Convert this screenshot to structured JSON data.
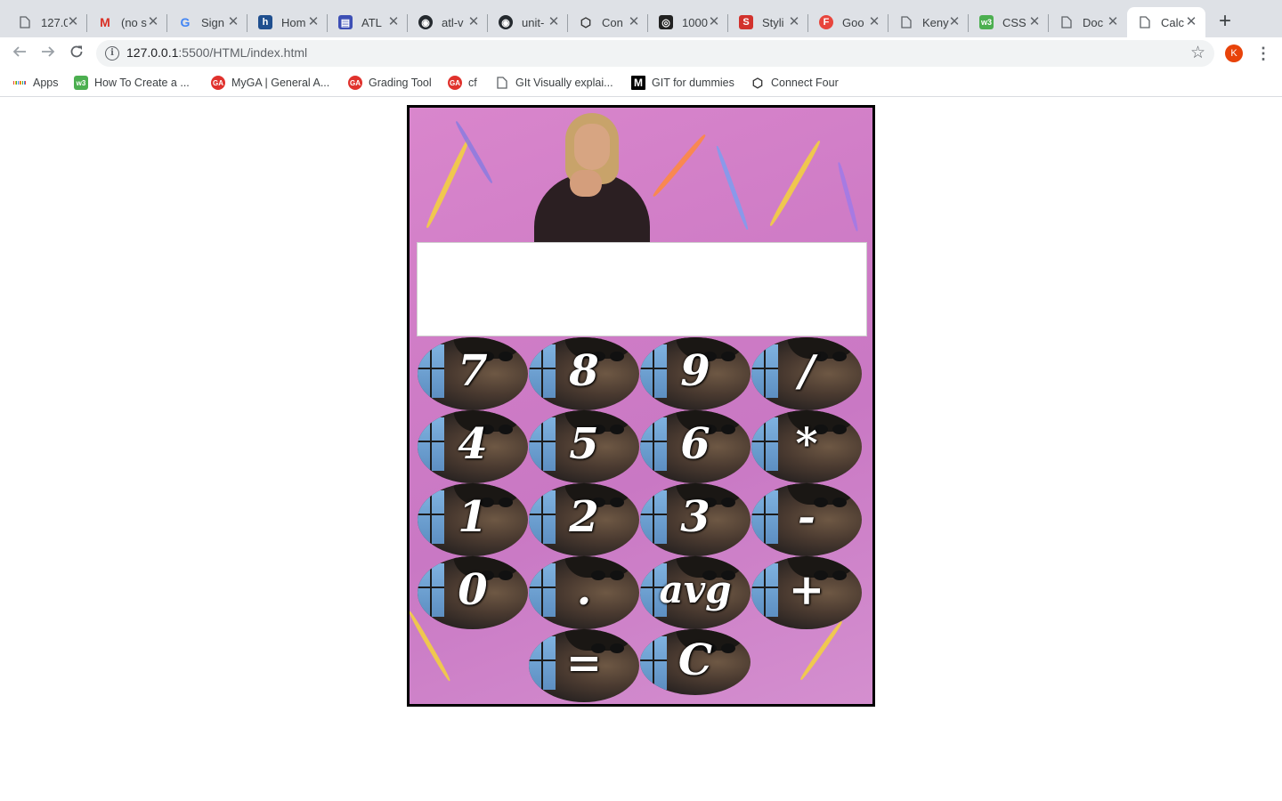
{
  "browser": {
    "tabs": [
      {
        "title": "127.0",
        "icon": "page-icon",
        "active": false
      },
      {
        "title": "(no s",
        "icon": "gmail-icon",
        "active": false
      },
      {
        "title": "Sign",
        "icon": "google-icon",
        "active": false
      },
      {
        "title": "Hom",
        "icon": "hackerrank-icon",
        "active": false
      },
      {
        "title": "ATL",
        "icon": "app-icon",
        "active": false
      },
      {
        "title": "atl-v",
        "icon": "github-icon",
        "active": false
      },
      {
        "title": "unit-",
        "icon": "github-icon",
        "active": false
      },
      {
        "title": "Con",
        "icon": "codepen-icon",
        "active": false
      },
      {
        "title": "1000",
        "icon": "instagram-icon",
        "active": false
      },
      {
        "title": "Styli",
        "icon": "s-icon",
        "active": false
      },
      {
        "title": "Goo",
        "icon": "f-icon",
        "active": false
      },
      {
        "title": "Keny",
        "icon": "page-icon",
        "active": false
      },
      {
        "title": "CSS",
        "icon": "w3schools-icon",
        "active": false
      },
      {
        "title": "Doc",
        "icon": "page-icon",
        "active": false
      },
      {
        "title": "Calc",
        "icon": "page-icon",
        "active": true
      }
    ],
    "url_host": "127.0.0.1",
    "url_rest": ":5500/HTML/index.html",
    "profile_initial": "K",
    "bookmarks": [
      {
        "label": "Apps",
        "icon": "apps-grid-icon"
      },
      {
        "label": "How To Create a ...",
        "icon": "w3schools-icon"
      },
      {
        "label": "MyGA | General A...",
        "icon": "ga-icon"
      },
      {
        "label": "Grading Tool",
        "icon": "ga-icon"
      },
      {
        "label": "cf",
        "icon": "ga-icon"
      },
      {
        "label": "GIt Visually explai...",
        "icon": "page-icon"
      },
      {
        "label": "GIT for dummies",
        "icon": "medium-icon"
      },
      {
        "label": "Connect Four",
        "icon": "codepen-icon"
      }
    ]
  },
  "calculator": {
    "display_value": "",
    "keys": [
      [
        "7",
        "8",
        "9",
        "/"
      ],
      [
        "4",
        "5",
        "6",
        "*"
      ],
      [
        "1",
        "2",
        "3",
        "-"
      ],
      [
        "0",
        ".",
        "avg",
        "+"
      ],
      [
        "=",
        "C"
      ]
    ]
  },
  "colors": {
    "calc_background": "#d283cb",
    "calc_border": "#000000",
    "display_background": "#ffffff",
    "key_label": "#ffffff"
  }
}
